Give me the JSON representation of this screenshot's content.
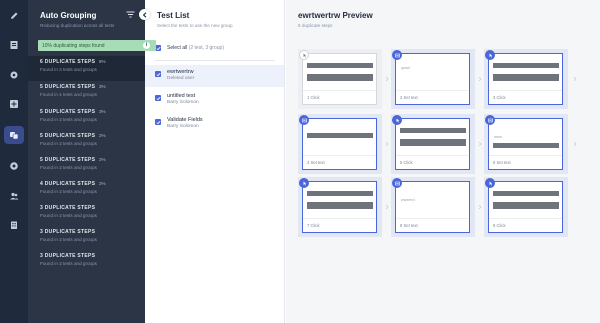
{
  "rail": {
    "icons": [
      "pencil-icon",
      "document-icon",
      "gear-icon",
      "add-box-icon",
      "grouping-icon",
      "settings-icon",
      "team-icon",
      "building-icon"
    ]
  },
  "grouping": {
    "title": "Auto Grouping",
    "subtitle": "Reducing duplication across all tests",
    "banner": "10% duplicating steps found",
    "banner_info": "i",
    "items": [
      {
        "title": "6 DUPLICATE STEPS",
        "pct": "8%",
        "sub": "Found in 3 tests and groups"
      },
      {
        "title": "5 DUPLICATE STEPS",
        "pct": "3%",
        "sub": "Found in 4 tests and groups"
      },
      {
        "title": "5 DUPLICATE STEPS",
        "pct": "3%",
        "sub": "Found in 3 tests and groups"
      },
      {
        "title": "5 DUPLICATE STEPS",
        "pct": "2%",
        "sub": "Found in 3 tests and groups"
      },
      {
        "title": "5 DUPLICATE STEPS",
        "pct": "2%",
        "sub": "Found in 3 tests and groups"
      },
      {
        "title": "4 DUPLICATE STEPS",
        "pct": "2%",
        "sub": "Found in 3 tests and groups"
      },
      {
        "title": "3 DUPLICATE STEPS",
        "pct": "",
        "sub": "Found in 3 tests and groups"
      },
      {
        "title": "3 DUPLICATE STEPS",
        "pct": "",
        "sub": "Found in 3 tests and groups"
      },
      {
        "title": "3 DUPLICATE STEPS",
        "pct": "",
        "sub": "Found in 3 tests and groups"
      }
    ]
  },
  "test_list": {
    "title": "Test List",
    "subtitle": "Select the tests to use the new group",
    "select_all": "Select all",
    "select_all_count": "(2 test, 3 group)",
    "tests": [
      {
        "name": "ewrtwertrw",
        "user": "Deleted user"
      },
      {
        "name": "untitled test",
        "user": "Barry Solomon"
      },
      {
        "name": "Validate Fields",
        "user": "Barry Solomon"
      }
    ]
  },
  "preview": {
    "title": "ewrtwertrw Preview",
    "subtitle": "6 duplicate steps",
    "cards": [
      {
        "label": "1 Click",
        "snippet": ""
      },
      {
        "label": "2 Set text",
        "snippet": "qwwe"
      },
      {
        "label": "3 Click",
        "snippet": ""
      },
      {
        "label": "4 Set text",
        "snippet": ""
      },
      {
        "label": "5 Click",
        "snippet": ""
      },
      {
        "label": "6 Set text",
        "snippet": "www"
      },
      {
        "label": "7 Click",
        "snippet": ""
      },
      {
        "label": "8 Set text",
        "snippet": "wwwee4"
      },
      {
        "label": "9 Click",
        "snippet": ""
      }
    ]
  },
  "colors": {
    "accent": "#4a66d8",
    "rail": "#1f2a3c",
    "panel": "#2b3546",
    "banner": "#a7dcb6"
  }
}
